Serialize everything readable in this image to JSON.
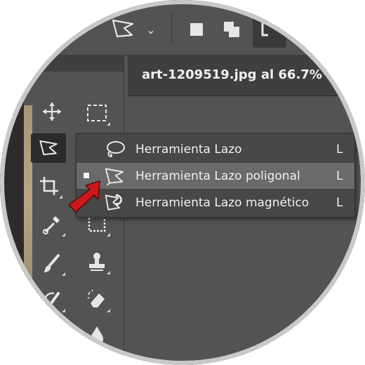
{
  "document": {
    "title": "art-1209519.jpg al 66.7%"
  },
  "options_bar": {
    "current_tool_icon": "polygonal-lasso-icon",
    "dropdown_icon": "chevron-down-icon",
    "selection_modes": [
      "new-selection-icon",
      "add-to-selection-icon",
      "subtract-from-selection-icon"
    ]
  },
  "tools": [
    {
      "icon": "move-icon"
    },
    {
      "icon": "rectangular-marquee-icon"
    },
    {
      "icon": "polygonal-lasso-icon",
      "active": true
    },
    {
      "icon": "crop-icon"
    },
    {
      "icon": "eyedropper-icon"
    },
    {
      "icon": "frame-icon"
    },
    {
      "icon": "brush-icon"
    },
    {
      "icon": "clone-stamp-icon"
    },
    {
      "icon": "history-brush-icon"
    },
    {
      "icon": "eraser-icon"
    },
    {
      "icon": "blur-icon"
    }
  ],
  "flyout": {
    "items": [
      {
        "label": "Herramienta Lazo",
        "shortcut": "L",
        "icon": "lasso-icon",
        "selected": false
      },
      {
        "label": "Herramienta Lazo poligonal",
        "shortcut": "L",
        "icon": "polygonal-lasso-icon",
        "selected": true
      },
      {
        "label": "Herramienta Lazo magnético",
        "shortcut": "L",
        "icon": "magnetic-lasso-icon",
        "selected": false
      }
    ]
  },
  "colors": {
    "workspace": "#535353",
    "panel_dark": "#3f3f3f",
    "flyout_bg": "#474747",
    "flyout_selected": "#6a6a6a",
    "arrow": "#cc1a1a",
    "text": "#f0f0f0"
  }
}
